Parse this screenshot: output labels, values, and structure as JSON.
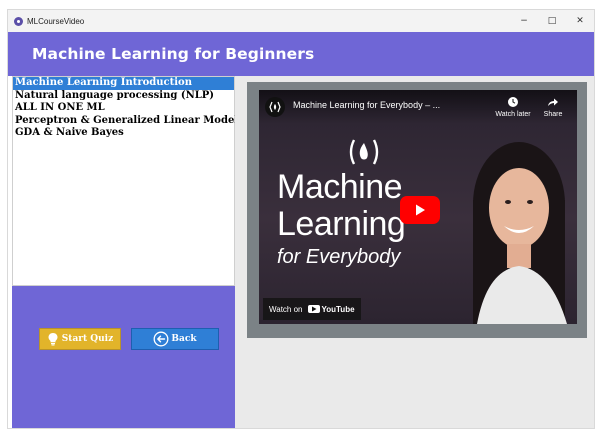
{
  "window": {
    "title": "MLCourseVideo",
    "controls": {
      "minimize": "−",
      "maximize": "□",
      "close": "✕"
    }
  },
  "header": {
    "title": "Machine Learning for Beginners",
    "background": "#6f66d6"
  },
  "course_list": {
    "items": [
      {
        "label": "Machine Learning Introduction",
        "selected": true
      },
      {
        "label": "Natural language processing (NLP)",
        "selected": false
      },
      {
        "label": "ALL IN ONE ML",
        "selected": false
      },
      {
        "label": "Perceptron & Generalized Linear Model",
        "selected": false
      },
      {
        "label": "GDA & Naive Bayes",
        "selected": false
      }
    ],
    "selected_color": "#2f7fd6"
  },
  "actions": {
    "start_quiz": {
      "label": "Start Quiz",
      "icon": "lightbulb-icon",
      "color": "#e2b42a"
    },
    "back": {
      "label": "Back",
      "icon": "back-arrow-icon",
      "color": "#2f7fd6"
    }
  },
  "video": {
    "title": "Machine Learning for Everybody – ...",
    "watch_later": "Watch later",
    "share": "Share",
    "thumbnail_line1": "Machine",
    "thumbnail_line2": "Learning",
    "thumbnail_line3": "for Everybody",
    "watch_on": "Watch on",
    "platform": "YouTube",
    "play_color": "#ff0000"
  }
}
